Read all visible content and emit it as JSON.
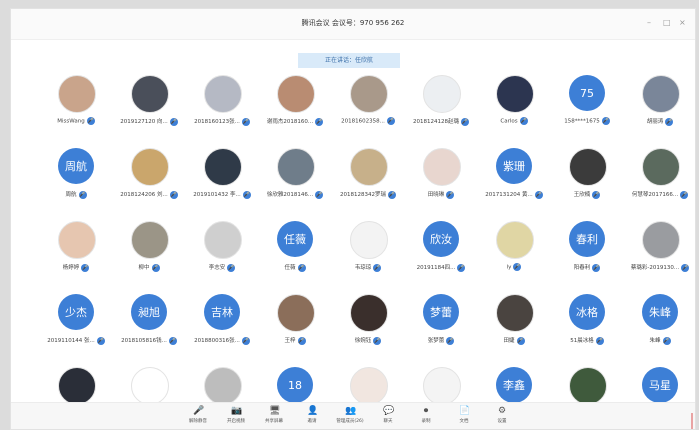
{
  "window": {
    "title": "腾讯会议 会议号：970 956 262"
  },
  "presenter_banner": "正在讲话：任欣航",
  "participants": [
    {
      "name": "MissWang",
      "avatar": "photo",
      "color": "#c9a48b"
    },
    {
      "name": "2019127120 向...",
      "avatar": "photo",
      "color": "#4a4f5a"
    },
    {
      "name": "2018160123张...",
      "avatar": "photo",
      "color": "#b5b9c4"
    },
    {
      "name": "谢雨杰2018160...",
      "avatar": "photo",
      "color": "#b98c72"
    },
    {
      "name": "20181602358...",
      "avatar": "photo",
      "color": "#a9998a"
    },
    {
      "name": "2018124128赵璐",
      "avatar": "photo",
      "color": "#eceff2"
    },
    {
      "name": "Carlos",
      "avatar": "photo",
      "color": "#2c3550"
    },
    {
      "name": "158****1675",
      "avatar": "text",
      "text": "75"
    },
    {
      "name": "胡丽涛",
      "avatar": "photo",
      "color": "#7a8699"
    },
    {
      "name": "周航",
      "avatar": "text",
      "text": "周航"
    },
    {
      "name": "2018124206 刘...",
      "avatar": "photo",
      "color": "#caa66c"
    },
    {
      "name": "2019101432 李...",
      "avatar": "photo",
      "color": "#2f3a48"
    },
    {
      "name": "徐欣雅2018146...",
      "avatar": "photo",
      "color": "#6f7d8a"
    },
    {
      "name": "2018128342罗瑞",
      "avatar": "photo",
      "color": "#c7b08a"
    },
    {
      "name": "田晓琳",
      "avatar": "photo",
      "color": "#e8d6cf"
    },
    {
      "name": "2017131204 黄...",
      "avatar": "text",
      "text": "紫珊"
    },
    {
      "name": "王欣楠",
      "avatar": "photo",
      "color": "#3b3b3b"
    },
    {
      "name": "何慧琴2017166...",
      "avatar": "photo",
      "color": "#5b6a5e"
    },
    {
      "name": "杨婷婷",
      "avatar": "photo",
      "color": "#e6c6b0"
    },
    {
      "name": "柳中",
      "avatar": "photo",
      "color": "#9b9587"
    },
    {
      "name": "李志安",
      "avatar": "photo",
      "color": "#cfcfcf"
    },
    {
      "name": "任薇",
      "avatar": "text",
      "text": "任薇"
    },
    {
      "name": "韦琼琼",
      "avatar": "photo",
      "color": "#f3f3f3"
    },
    {
      "name": "20191184四...",
      "avatar": "text",
      "text": "欣汝"
    },
    {
      "name": "ly",
      "avatar": "photo",
      "color": "#e0d6a4"
    },
    {
      "name": "阳春利",
      "avatar": "text",
      "text": "春利"
    },
    {
      "name": "蔡璐彩-2019130...",
      "avatar": "photo",
      "color": "#9a9ca0"
    },
    {
      "name": "2019110144 张...",
      "avatar": "text",
      "text": "少杰"
    },
    {
      "name": "2018105816钱...",
      "avatar": "text",
      "text": "昶旭"
    },
    {
      "name": "2018800316张...",
      "avatar": "text",
      "text": "吉林"
    },
    {
      "name": "王梓",
      "avatar": "photo",
      "color": "#8b6e5a"
    },
    {
      "name": "徐婉钰",
      "avatar": "photo",
      "color": "#3a2f2c"
    },
    {
      "name": "张梦蕾",
      "avatar": "text",
      "text": "梦蕾"
    },
    {
      "name": "田婕",
      "avatar": "photo",
      "color": "#4a4440"
    },
    {
      "name": "51晨冰格",
      "avatar": "text",
      "text": "冰格"
    },
    {
      "name": "朱峰",
      "avatar": "text",
      "text": "朱峰"
    },
    {
      "name": "",
      "avatar": "photo",
      "color": "#2a2e38"
    },
    {
      "name": "",
      "avatar": "photo",
      "color": "#ffffff"
    },
    {
      "name": "",
      "avatar": "photo",
      "color": "#bdbdbd"
    },
    {
      "name": "",
      "avatar": "text",
      "text": "18"
    },
    {
      "name": "",
      "avatar": "photo",
      "color": "#f1e6e0"
    },
    {
      "name": "",
      "avatar": "photo",
      "color": "#f4f4f4"
    },
    {
      "name": "",
      "avatar": "text",
      "text": "李鑫"
    },
    {
      "name": "",
      "avatar": "photo",
      "color": "#3f5a3c"
    },
    {
      "name": "",
      "avatar": "text",
      "text": "马星"
    }
  ],
  "toolbar": [
    {
      "label": "解除静音",
      "icon": "mic-icon"
    },
    {
      "label": "开启视频",
      "icon": "camera-icon"
    },
    {
      "label": "共享屏幕",
      "icon": "screen-share-icon"
    },
    {
      "label": "邀请",
      "icon": "invite-icon"
    },
    {
      "label": "管理成员(26)",
      "icon": "members-icon"
    },
    {
      "label": "聊天",
      "icon": "chat-icon"
    },
    {
      "label": "录制",
      "icon": "record-icon"
    },
    {
      "label": "文档",
      "icon": "doc-icon"
    },
    {
      "label": "设置",
      "icon": "settings-icon"
    }
  ],
  "colors": {
    "accent": "#3d7fd6",
    "banner_bg": "#d9eaf9",
    "banner_text": "#3a6ea8"
  }
}
